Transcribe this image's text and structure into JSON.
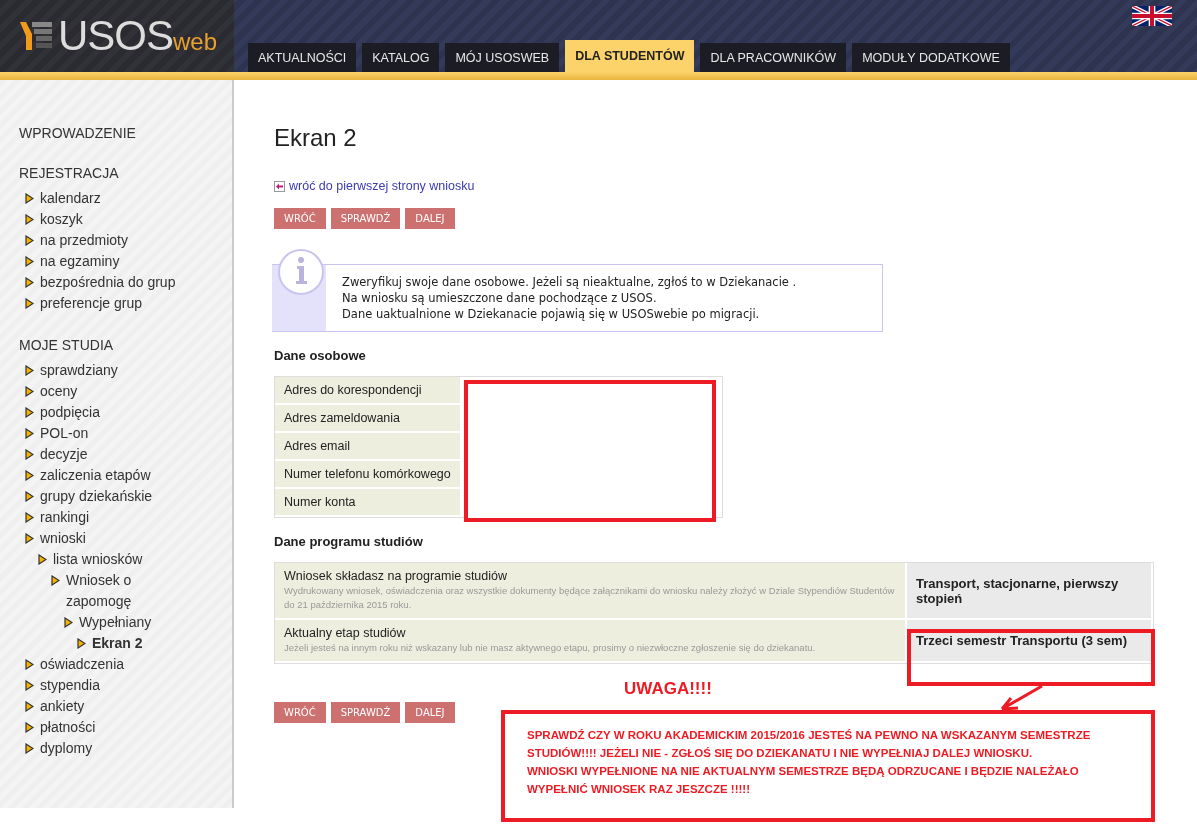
{
  "logo": {
    "main": "USOS",
    "suffix": "web"
  },
  "tabs": [
    {
      "label": "AKTUALNOŚCI",
      "selected": false
    },
    {
      "label": "KATALOG",
      "selected": false
    },
    {
      "label": "MÓJ USOSWEB",
      "selected": false
    },
    {
      "label": "DLA STUDENTÓW",
      "selected": true
    },
    {
      "label": "DLA PRACOWNIKÓW",
      "selected": false
    },
    {
      "label": "MODUŁY DODATKOWE",
      "selected": false
    }
  ],
  "sidebar": {
    "sections": [
      {
        "heading": "WPROWADZENIE"
      },
      {
        "heading": "REJESTRACJA",
        "items": [
          {
            "label": "kalendarz",
            "selected": false
          },
          {
            "label": "koszyk",
            "selected": false
          },
          {
            "label": "na przedmioty",
            "selected": false
          },
          {
            "label": "na egzaminy",
            "selected": false
          },
          {
            "label": "bezpośrednia do grup",
            "selected": false
          },
          {
            "label": "preferencje grup",
            "selected": false
          }
        ]
      },
      {
        "heading": "MOJE STUDIA",
        "items": [
          {
            "label": "sprawdziany",
            "selected": false
          },
          {
            "label": "oceny",
            "selected": false
          },
          {
            "label": "podpięcia",
            "selected": false
          },
          {
            "label": "POL-on",
            "selected": false
          },
          {
            "label": "decyzje",
            "selected": false
          },
          {
            "label": "zaliczenia etapów",
            "selected": false
          },
          {
            "label": "grupy dziekańskie",
            "selected": false
          },
          {
            "label": "rankingi",
            "selected": false
          },
          {
            "label": "wnioski",
            "selected": false,
            "children": [
              {
                "label": "lista wniosków",
                "selected": false,
                "children": [
                  {
                    "label": "Wniosek o zapomogę",
                    "selected": false,
                    "children": [
                      {
                        "label": "Wypełniany",
                        "selected": false,
                        "children": [
                          {
                            "label": "Ekran 2",
                            "selected": true
                          }
                        ]
                      }
                    ]
                  }
                ]
              }
            ]
          },
          {
            "label": "oświadczenia",
            "selected": false
          },
          {
            "label": "stypendia",
            "selected": false
          },
          {
            "label": "ankiety",
            "selected": false
          },
          {
            "label": "płatności",
            "selected": false
          },
          {
            "label": "dyplomy",
            "selected": false
          }
        ]
      }
    ]
  },
  "main": {
    "title": "Ekran 2",
    "back_link": "wróć do pierwszej strony wniosku",
    "buttons_top": [
      "WRÓĆ",
      "SPRAWDŹ",
      "DALEJ"
    ],
    "info": [
      "Zweryfikuj swoje dane osobowe. Jeżeli są nieaktualne, zgłoś to w Dziekanacie .",
      "Na wniosku są umieszczone dane pochodzące z USOS.",
      "Dane uaktualnione w Dziekanacie pojawią się w USOSwebie po migracji."
    ],
    "personal": {
      "heading": "Dane osobowe",
      "rows": [
        "Adres do korespondencji",
        "Adres zameldowania",
        "Adres email",
        "Numer telefonu komórkowego",
        "Numer konta"
      ]
    },
    "program": {
      "heading": "Dane programu studiów",
      "rows": [
        {
          "label": "Wniosek składasz na programie studiów",
          "hint": "Wydrukowany wniosek, oświadczenia oraz wszystkie dokumenty będące załącznikami do wniosku należy złożyć w Dziale Stypendiów Studentów do 21 października 2015 roku.",
          "value": "Transport, stacjonarne, pierwszy stopień"
        },
        {
          "label": "Aktualny etap studiów",
          "hint": "Jeżeli jesteś na innym roku niż wskazany lub nie masz aktywnego etapu, prosimy o niezwłoczne zgłoszenie się do dziekanatu.",
          "value": "Trzeci semestr Transportu (3 sem)"
        }
      ]
    },
    "buttons_bottom": [
      "WRÓĆ",
      "SPRAWDŹ",
      "DALEJ"
    ],
    "annotation": {
      "heading": "UWAGA!!!!",
      "lines": [
        "SPRAWDŹ CZY W ROKU AKADEMICKIM 2015/2016 JESTEŚ NA PEWNO NA WSKAZANYM SEMESTRZE STUDIÓW!!!! JEŻELI NIE - ZGŁOŚ SIĘ DO DZIEKANATU I NIE WYPEŁNIAJ DALEJ WNIOSKU.",
        "WNIOSKI WYPEŁNIONE NA NIE AKTUALNYM SEMESTRZE BĘDĄ ODRZUCANE I BĘDZIE NALEŻAŁO WYPEŁNIĆ WNIOSEK RAZ JESZCZE !!!!!"
      ]
    }
  }
}
